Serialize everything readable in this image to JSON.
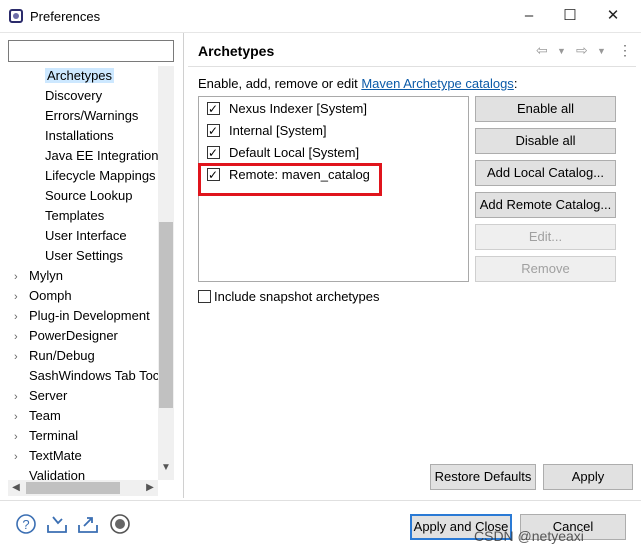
{
  "window": {
    "title": "Preferences",
    "controls": [
      "–",
      "☐",
      "✕"
    ]
  },
  "filter": {
    "value": "",
    "placeholder": ""
  },
  "tree": {
    "items": [
      {
        "label": "Archetypes",
        "indent": 2,
        "expandable": false,
        "selected": true
      },
      {
        "label": "Discovery",
        "indent": 2,
        "expandable": false
      },
      {
        "label": "Errors/Warnings",
        "indent": 2,
        "expandable": false
      },
      {
        "label": "Installations",
        "indent": 2,
        "expandable": false
      },
      {
        "label": "Java EE Integration",
        "indent": 2,
        "expandable": false
      },
      {
        "label": "Lifecycle Mappings",
        "indent": 2,
        "expandable": false
      },
      {
        "label": "Source Lookup",
        "indent": 2,
        "expandable": false
      },
      {
        "label": "Templates",
        "indent": 2,
        "expandable": false
      },
      {
        "label": "User Interface",
        "indent": 2,
        "expandable": false
      },
      {
        "label": "User Settings",
        "indent": 2,
        "expandable": false
      },
      {
        "label": "Mylyn",
        "indent": 0,
        "expandable": true
      },
      {
        "label": "Oomph",
        "indent": 0,
        "expandable": true
      },
      {
        "label": "Plug-in Development",
        "indent": 0,
        "expandable": true
      },
      {
        "label": "PowerDesigner",
        "indent": 0,
        "expandable": true
      },
      {
        "label": "Run/Debug",
        "indent": 0,
        "expandable": true
      },
      {
        "label": "SashWindows Tab Toc",
        "indent": 1,
        "expandable": false
      },
      {
        "label": "Server",
        "indent": 0,
        "expandable": true
      },
      {
        "label": "Team",
        "indent": 0,
        "expandable": true
      },
      {
        "label": "Terminal",
        "indent": 0,
        "expandable": true
      },
      {
        "label": "TextMate",
        "indent": 0,
        "expandable": true
      },
      {
        "label": "Validation",
        "indent": 1,
        "expandable": false
      }
    ]
  },
  "page": {
    "title": "Archetypes",
    "description_prefix": "Enable, add, remove or edit ",
    "description_link": "Maven Archetype catalogs",
    "description_suffix": ":",
    "catalogs": [
      {
        "label": "Nexus Indexer [System]",
        "checked": true
      },
      {
        "label": "Internal [System]",
        "checked": true
      },
      {
        "label": "Default Local [System]",
        "checked": true
      },
      {
        "label": "Remote: maven_catalog",
        "checked": true
      }
    ],
    "buttons": {
      "enable_all": "Enable all",
      "disable_all": "Disable all",
      "add_local": "Add Local Catalog...",
      "add_remote": "Add Remote Catalog...",
      "edit": "Edit...",
      "remove": "Remove"
    },
    "snapshot_label": "Include snapshot archetypes",
    "snapshot_checked": false,
    "restore_defaults": "Restore Defaults",
    "apply": "Apply"
  },
  "footer": {
    "apply_close": "Apply and Close",
    "cancel": "Cancel",
    "watermark": "CSDN @netyeaxi"
  },
  "colors": {
    "selection": "#cde8ff",
    "highlight_border": "#e0141c",
    "link": "#0b5aa8",
    "default_button_border": "#2a7ad5"
  }
}
